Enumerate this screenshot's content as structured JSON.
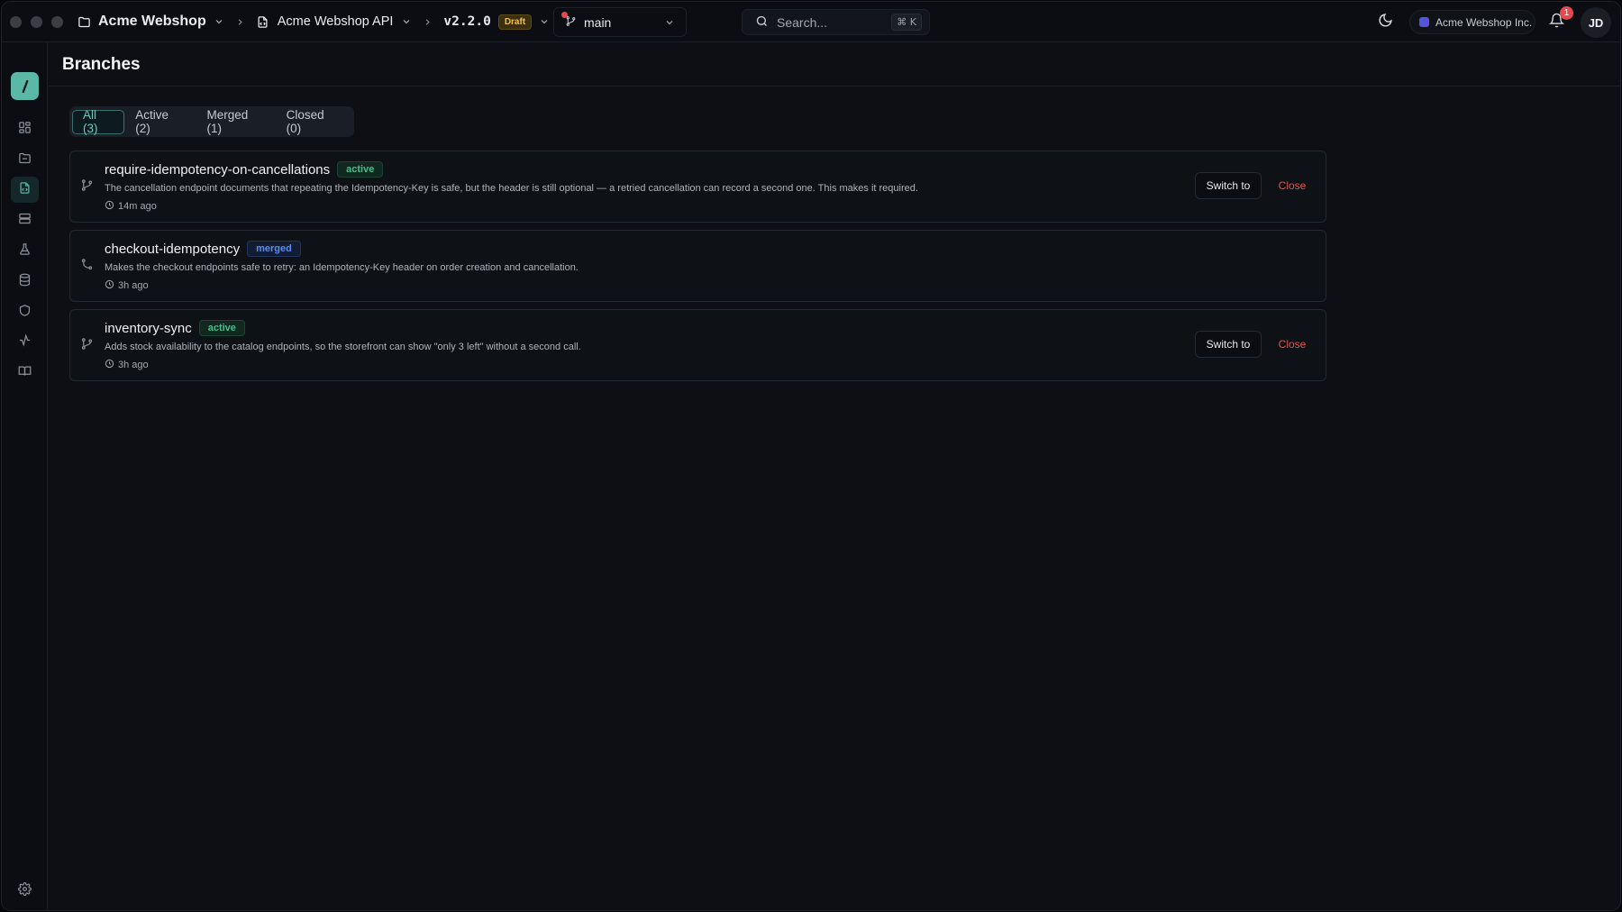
{
  "topbar": {
    "project": "Acme Webshop",
    "api": "Acme Webshop API",
    "version": "v2.2.0",
    "version_status": "Draft",
    "branch": "main",
    "search_placeholder": "Search...",
    "search_shortcut": "⌘ K",
    "organization": "Acme Webshop Inc.",
    "notification_count": "1",
    "user_initials": "JD"
  },
  "sidebar": {
    "items": [
      {
        "icon": "dashboard-icon",
        "active": false
      },
      {
        "icon": "folder-icon",
        "active": false
      },
      {
        "icon": "api-file-icon",
        "active": true
      },
      {
        "icon": "servers-icon",
        "active": false
      },
      {
        "icon": "flask-icon",
        "active": false
      },
      {
        "icon": "database-icon",
        "active": false
      },
      {
        "icon": "shield-icon",
        "active": false
      },
      {
        "icon": "activity-icon",
        "active": false
      },
      {
        "icon": "book-icon",
        "active": false
      }
    ],
    "settings_icon": "gear-icon"
  },
  "page": {
    "title": "Branches",
    "tabs": [
      {
        "label": "All (3)",
        "active": true
      },
      {
        "label": "Active (2)",
        "active": false
      },
      {
        "label": "Merged (1)",
        "active": false
      },
      {
        "label": "Closed (0)",
        "active": false
      }
    ],
    "branches": [
      {
        "name": "require-idempotency-on-cancellations",
        "status": "active",
        "description": "The cancellation endpoint documents that repeating the Idempotency-Key is safe, but the header is still optional — a retried cancellation can record a second one. This makes it required.",
        "time": "14m ago",
        "switch_label": "Switch to",
        "close_label": "Close"
      },
      {
        "name": "checkout-idempotency",
        "status": "merged",
        "description": "Makes the checkout endpoints safe to retry: an Idempotency-Key header on order creation and cancellation.",
        "time": "3h ago"
      },
      {
        "name": "inventory-sync",
        "status": "active",
        "description": "Adds stock availability to the catalog endpoints, so the storefront can show \"only 3 left\" without a second call.",
        "time": "3h ago",
        "switch_label": "Switch to",
        "close_label": "Close"
      }
    ]
  },
  "colors": {
    "accent": "#4fb7a4",
    "active_status": "#44c08f",
    "merged_status": "#5b8cf0",
    "danger": "#e5534b",
    "draft": "#f1c04c"
  }
}
